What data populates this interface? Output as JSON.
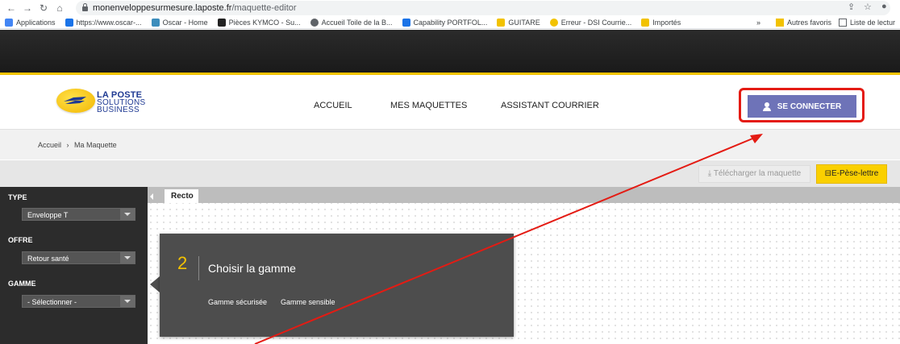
{
  "browser": {
    "url_host": "monenveloppesurmesure.laposte.fr",
    "url_path": "/maquette-editor",
    "bookmarks": [
      {
        "label": "Applications",
        "color": "#4285f4"
      },
      {
        "label": "https://www.oscar-...",
        "color": "#1a73e8"
      },
      {
        "label": "Oscar - Home",
        "color": "#3c8dbc"
      },
      {
        "label": "Pièces KYMCO - Su...",
        "color": "#222222"
      },
      {
        "label": "Accueil Toile de la B...",
        "color": "#5f6368"
      },
      {
        "label": "Capability PORTFOL...",
        "color": "#1a73e8"
      },
      {
        "label": "GUITARE",
        "color": "#f2c200"
      },
      {
        "label": "Erreur - DSI Courrie...",
        "color": "#f2c200"
      },
      {
        "label": "Importés",
        "color": "#f2c200"
      }
    ],
    "bookmarks_overflow": "»",
    "other_favorites": "Autres favoris",
    "reading_list": "Liste de lectur"
  },
  "site": {
    "logo": {
      "line1": "LA POSTE",
      "line2": "SOLUTIONS",
      "line3": "BUSINESS"
    },
    "nav": [
      "ACCUEIL",
      "MES MAQUETTES",
      "ASSISTANT COURRIER"
    ],
    "connect_label": "SE CONNECTER",
    "breadcrumb": {
      "home": "Accueil",
      "separator": "›",
      "current": "Ma Maquette"
    },
    "toolbar": {
      "download_label": "Télécharger la maquette",
      "pese_label": "E-Pèse-lettre"
    },
    "sidebar": {
      "type_label": "TYPE",
      "type_value": "Enveloppe T",
      "offre_label": "OFFRE",
      "offre_value": "Retour santé",
      "gamme_label": "GAMME",
      "gamme_value": "- Sélectionner -"
    },
    "tab_label": "Recto",
    "step": {
      "number": "2",
      "title": "Choisir la gamme",
      "options": [
        "Gamme sécurisée",
        "Gamme sensible"
      ]
    }
  },
  "colors": {
    "accent_yellow": "#f4c300",
    "connect_btn": "#6e73b8",
    "annotation_red": "#e41b13"
  }
}
